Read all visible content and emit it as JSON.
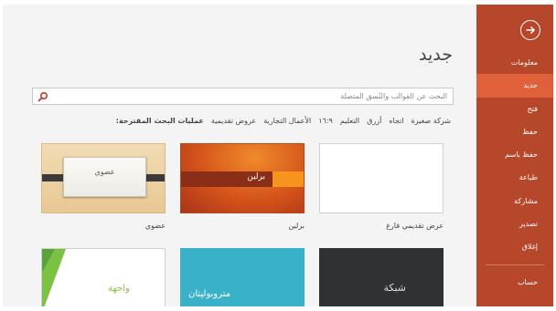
{
  "sidebar": {
    "items": [
      {
        "label": "معلومات",
        "active": false
      },
      {
        "label": "جديد",
        "active": true
      },
      {
        "label": "فتح",
        "active": false
      },
      {
        "label": "حفظ",
        "active": false
      },
      {
        "label": "حفظ باسم",
        "active": false
      },
      {
        "label": "طباعة",
        "active": false
      },
      {
        "label": "مشاركة",
        "active": false
      },
      {
        "label": "تصدير",
        "active": false
      },
      {
        "label": "إغلاق",
        "active": false
      }
    ],
    "account_label": "حساب",
    "back_icon": "arrow-right-circle-icon",
    "color": "#b7472a",
    "active_color": "#e0603a"
  },
  "main": {
    "title": "جديد",
    "search": {
      "placeholder": "البحث عن القوالب والنُسق المتصلة",
      "value": "",
      "icon": "search-icon",
      "icon_color": "#c0392b"
    },
    "suggested": {
      "label": "عمليات البحث المقترحة:",
      "links": [
        "عروض تقديمية",
        "الأعمال التجارية",
        "١٦:٩",
        "التعليم",
        "أزرق",
        "اتجاه",
        "شركة صغيرة"
      ]
    },
    "templates": [
      {
        "name": "عرض تقديمي فارغ",
        "thumb_text": ""
      },
      {
        "name": "برلين",
        "thumb_text": "برلين"
      },
      {
        "name": "عضوي",
        "thumb_text": "عضوي"
      },
      {
        "name": "",
        "thumb_text": "شبكة"
      },
      {
        "name": "",
        "thumb_text": "متروبوليتان"
      },
      {
        "name": "",
        "thumb_text": "واجهة"
      }
    ]
  }
}
